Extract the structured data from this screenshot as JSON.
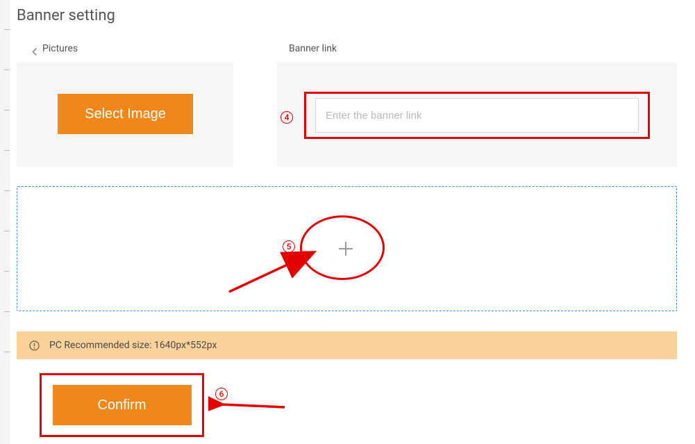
{
  "page": {
    "title": "Banner setting"
  },
  "labels": {
    "pictures": "Pictures",
    "banner_link": "Banner link"
  },
  "buttons": {
    "select_image": "Select Image",
    "confirm": "Confirm"
  },
  "inputs": {
    "banner_link": {
      "value": "",
      "placeholder": "Enter the banner link"
    }
  },
  "info_bar": {
    "text": "PC Recommended size: 1640px*552px"
  },
  "callouts": {
    "step4": "4",
    "step5": "5",
    "step6": "6"
  },
  "colors": {
    "accent": "#f0871a",
    "annotation": "#e20000",
    "dashed_border": "#3b8be0",
    "info_bg": "#fbd19b"
  }
}
